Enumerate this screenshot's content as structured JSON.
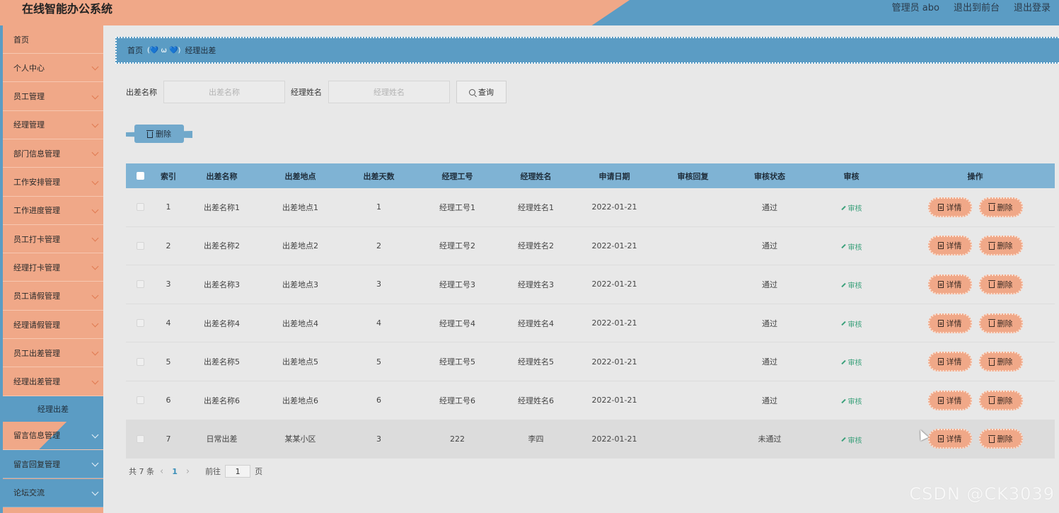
{
  "header": {
    "title": "在线智能办公系统",
    "user": "管理员 abo",
    "to_front": "退出到前台",
    "logout": "退出登录"
  },
  "sidebar": {
    "items": [
      {
        "label": "首页",
        "chevron": false
      },
      {
        "label": "个人中心",
        "chevron": true
      },
      {
        "label": "员工管理",
        "chevron": true
      },
      {
        "label": "经理管理",
        "chevron": true
      },
      {
        "label": "部门信息管理",
        "chevron": true
      },
      {
        "label": "工作安排管理",
        "chevron": true
      },
      {
        "label": "工作进度管理",
        "chevron": true
      },
      {
        "label": "员工打卡管理",
        "chevron": true
      },
      {
        "label": "经理打卡管理",
        "chevron": true
      },
      {
        "label": "员工请假管理",
        "chevron": true
      },
      {
        "label": "经理请假管理",
        "chevron": true
      },
      {
        "label": "员工出差管理",
        "chevron": true
      },
      {
        "label": "经理出差管理",
        "chevron": true
      }
    ],
    "active_sub": "经理出差",
    "lower_items": [
      {
        "label": "留言信息管理"
      },
      {
        "label": "留言回复管理"
      },
      {
        "label": "论坛交流"
      }
    ]
  },
  "breadcrumb": {
    "home": "首页",
    "separator": "(💙 ω 💙)",
    "current": "经理出差"
  },
  "search": {
    "field1_label": "出差名称",
    "field1_placeholder": "出差名称",
    "field2_label": "经理姓名",
    "field2_placeholder": "经理姓名",
    "button": "查询"
  },
  "toolbar": {
    "delete_label": "删除"
  },
  "table": {
    "headers": [
      "索引",
      "出差名称",
      "出差地点",
      "出差天数",
      "经理工号",
      "经理姓名",
      "申请日期",
      "审核回复",
      "审核状态",
      "审核",
      "操作"
    ],
    "audit_label": "审核",
    "detail_label": "详情",
    "delete_label": "删除",
    "rows": [
      {
        "idx": "1",
        "name": "出差名称1",
        "place": "出差地点1",
        "days": "1",
        "no": "经理工号1",
        "mgr": "经理姓名1",
        "date": "2022-01-21",
        "reply": "",
        "status": "通过"
      },
      {
        "idx": "2",
        "name": "出差名称2",
        "place": "出差地点2",
        "days": "2",
        "no": "经理工号2",
        "mgr": "经理姓名2",
        "date": "2022-01-21",
        "reply": "",
        "status": "通过"
      },
      {
        "idx": "3",
        "name": "出差名称3",
        "place": "出差地点3",
        "days": "3",
        "no": "经理工号3",
        "mgr": "经理姓名3",
        "date": "2022-01-21",
        "reply": "",
        "status": "通过"
      },
      {
        "idx": "4",
        "name": "出差名称4",
        "place": "出差地点4",
        "days": "4",
        "no": "经理工号4",
        "mgr": "经理姓名4",
        "date": "2022-01-21",
        "reply": "",
        "status": "通过"
      },
      {
        "idx": "5",
        "name": "出差名称5",
        "place": "出差地点5",
        "days": "5",
        "no": "经理工号5",
        "mgr": "经理姓名5",
        "date": "2022-01-21",
        "reply": "",
        "status": "通过"
      },
      {
        "idx": "6",
        "name": "出差名称6",
        "place": "出差地点6",
        "days": "6",
        "no": "经理工号6",
        "mgr": "经理姓名6",
        "date": "2022-01-21",
        "reply": "",
        "status": "通过"
      },
      {
        "idx": "7",
        "name": "日常出差",
        "place": "某某小区",
        "days": "3",
        "no": "222",
        "mgr": "李四",
        "date": "2022-01-21",
        "reply": "",
        "status": "未通过"
      }
    ]
  },
  "pagination": {
    "total": "共 7 条",
    "current_page": "1",
    "goto_label": "前往",
    "goto_value": "1",
    "page_suffix": "页"
  },
  "watermark": "CSDN @CK3039",
  "colors": {
    "salmon": "#f0a888",
    "blue": "#5b9cc4",
    "audit_green": "#3aa07a"
  }
}
